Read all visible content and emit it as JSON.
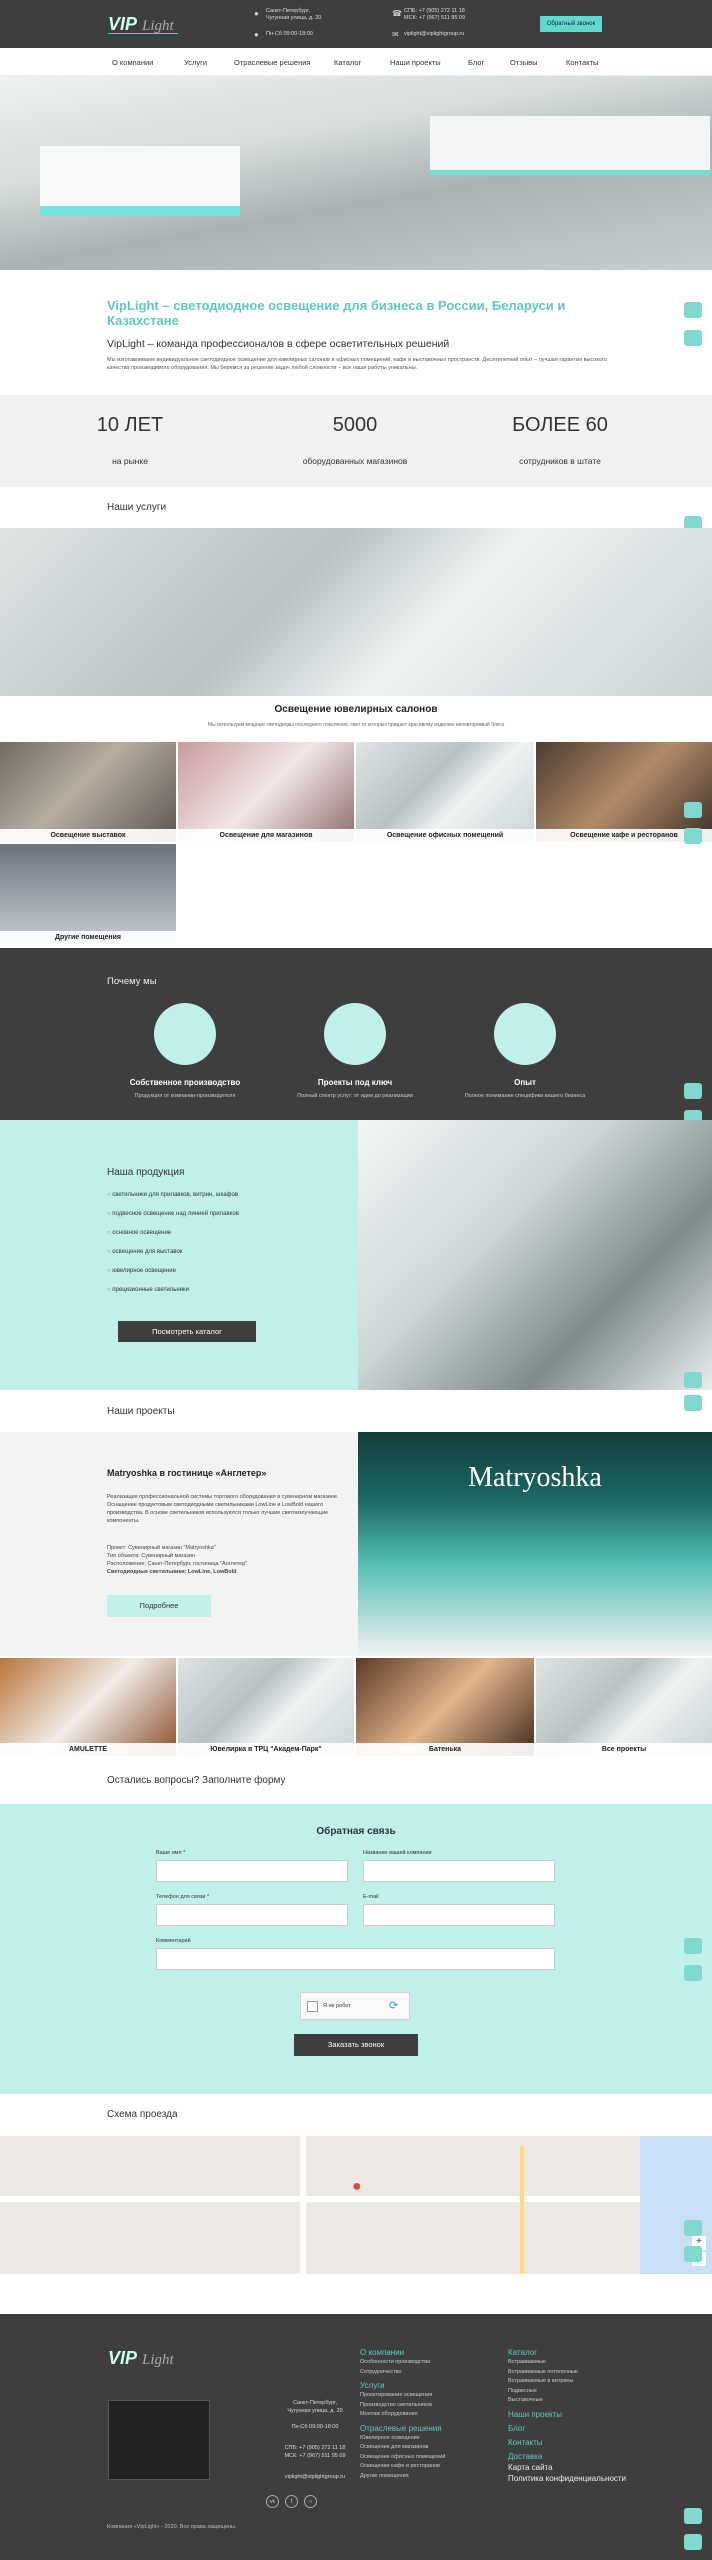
{
  "header": {
    "logo": "VipLight",
    "addr1": "Санкт-Петербург,",
    "addr2": "Чугунная улица, д. 20",
    "hours": "Пн-Сб 09:00-18:00",
    "phone1": "СПБ: +7 (905) 272 11 18",
    "phone2": "МСК: +7 (967) 511 95 09",
    "email": "viplight@viplightgroup.ru",
    "cta": "Обратный звонок"
  },
  "nav": [
    "О компании",
    "Услуги",
    "Отраслевые решения",
    "Каталог",
    "Наши проекты",
    "Блог",
    "Отзывы",
    "Контакты"
  ],
  "intro": {
    "title": "VipLight – светодиодное освещение для бизнеса в России, Беларуси и Казахстане",
    "subtitle": "VipLight – команда профессионалов в сфере осветительных решений",
    "text": "Мы изготавливаем индивидуальное светодиодное освещение для ювелирных салонов и офисных помещений, кафе и выставочных пространств. Десятилетний опыт – лучшая гарантия высокого качества производимого оборудования. Мы беремся за решение задач любой сложности – все наши работы уникальны."
  },
  "stats": [
    {
      "value": "10 ЛЕТ",
      "label": "на рынке"
    },
    {
      "value": "5000",
      "label": "оборудованных магазинов"
    },
    {
      "value": "БОЛЕЕ 60",
      "label": "сотрудников в штате"
    }
  ],
  "services": {
    "heading": "Наши услуги",
    "feature_title": "Освещение ювелирных салонов",
    "feature_text": "Мы используем мощные светодиоды последнего поколения, свет от которых придает красивому изделию неповторимый блеск",
    "tiles": [
      "Освещение выставок",
      "Освещение для магазинов",
      "Освещение офисных помещений",
      "Освещение кафе и ресторанов",
      "Другие помещения"
    ]
  },
  "why": {
    "heading": "Почему мы",
    "items": [
      {
        "title": "Собственное производство",
        "text": "Продукция от компании-производителя"
      },
      {
        "title": "Проекты под ключ",
        "text": "Полный спектр услуг: от идеи до реализации"
      },
      {
        "title": "Опыт",
        "text": "Полное понимание специфики вашего бизнеса"
      }
    ]
  },
  "products": {
    "heading": "Наша продукция",
    "items": [
      "светильники для прилавков, витрин, шкафов",
      "подвесное освещение над лини­ей прилавков",
      "основное освещение",
      "освещение для выставок",
      "ювелирное освещение",
      "прецизионные светильники"
    ],
    "button": "Посмотреть каталог"
  },
  "projects": {
    "heading": "Наши проекты",
    "title": "Matryoshka в гостинице «Англетер»",
    "p1": "Реализация профессиональной системы торгового оборудования в сувенирном магазине. Оснащение продуктовым светодиодными светильниками LowLine и LowBold нашего производства. В основе светильников используются только лучшие светоизлучающие компоненты.",
    "line1": "Проект: Сувенирный магазин \"Matryoshka\"",
    "line2": "Тип объекта: Сувенирный магазин",
    "line3": "Расположение: Санкт-Петербург, гостиница \"Англетер\"",
    "line4": "Светодиодные светильники: LowLine, LowBold",
    "button": "Подробнее",
    "sign": "Matryoshka",
    "tiles": [
      "AMULETTE",
      "Ювелирка в ТРЦ \"Академ-Парк\"",
      "Батенька",
      "Все проекты"
    ]
  },
  "form": {
    "heading": "Остались вопросы? Заполните форму",
    "title": "Обратная связь",
    "f1": "Ваше имя *",
    "f2": "Название вашей компании",
    "f3": "Телефон для связи *",
    "f4": "E-mail",
    "f5": "Комментарий",
    "captcha": "Я не робот",
    "submit": "Заказать звонок"
  },
  "map": {
    "heading": "Схема проезда"
  },
  "footer": {
    "addr1": "Санкт-Петербург,",
    "addr2": "Чугунная улица, д. 20",
    "hours": "Пн-Сб 09:00-18:00",
    "phone1": "СПБ: +7 (905) 272 11 18",
    "phone2": "МСК: +7 (967) 511 95 09",
    "email": "viplight@viplightgroup.ru",
    "copyright": "Компания «VipLight» - 2020. Все права защищены.",
    "col1": [
      {
        "t": "О компании",
        "h": 1
      },
      {
        "t": "Особенности производства"
      },
      {
        "t": "Сотрудничество"
      },
      {
        "t": "Услуги",
        "h": 1
      },
      {
        "t": "Проектирование освещения"
      },
      {
        "t": "Производство светильников"
      },
      {
        "t": "Монтаж оборудования"
      },
      {
        "t": "Отраслевые решения",
        "h": 1
      },
      {
        "t": "Ювелирное освещение"
      },
      {
        "t": "Освещение для магазинов"
      },
      {
        "t": "Освещение офисных помещений"
      },
      {
        "t": "Освещение кафе и ресторанов"
      },
      {
        "t": "Другие помещения"
      }
    ],
    "col2": [
      {
        "t": "Каталог",
        "h": 1
      },
      {
        "t": "Встраиваемые"
      },
      {
        "t": "Встраиваемые потолочные"
      },
      {
        "t": "Встраиваемые в витрины"
      },
      {
        "t": "Подвесные"
      },
      {
        "t": "Выставочные"
      },
      {
        "t": "Наши проекты",
        "h": 1
      },
      {
        "t": "Блог",
        "h": 1
      },
      {
        "t": "Контакты",
        "h": 1
      },
      {
        "t": "Доставка",
        "h": 1
      },
      {
        "t": "Карта сайта",
        "h": 2
      },
      {
        "t": "Политика конфиденциальности",
        "h": 2
      }
    ]
  },
  "colors": {
    "accent": "#5fc9c0",
    "mint": "#bff0ea",
    "dark": "#3e3e3e"
  }
}
